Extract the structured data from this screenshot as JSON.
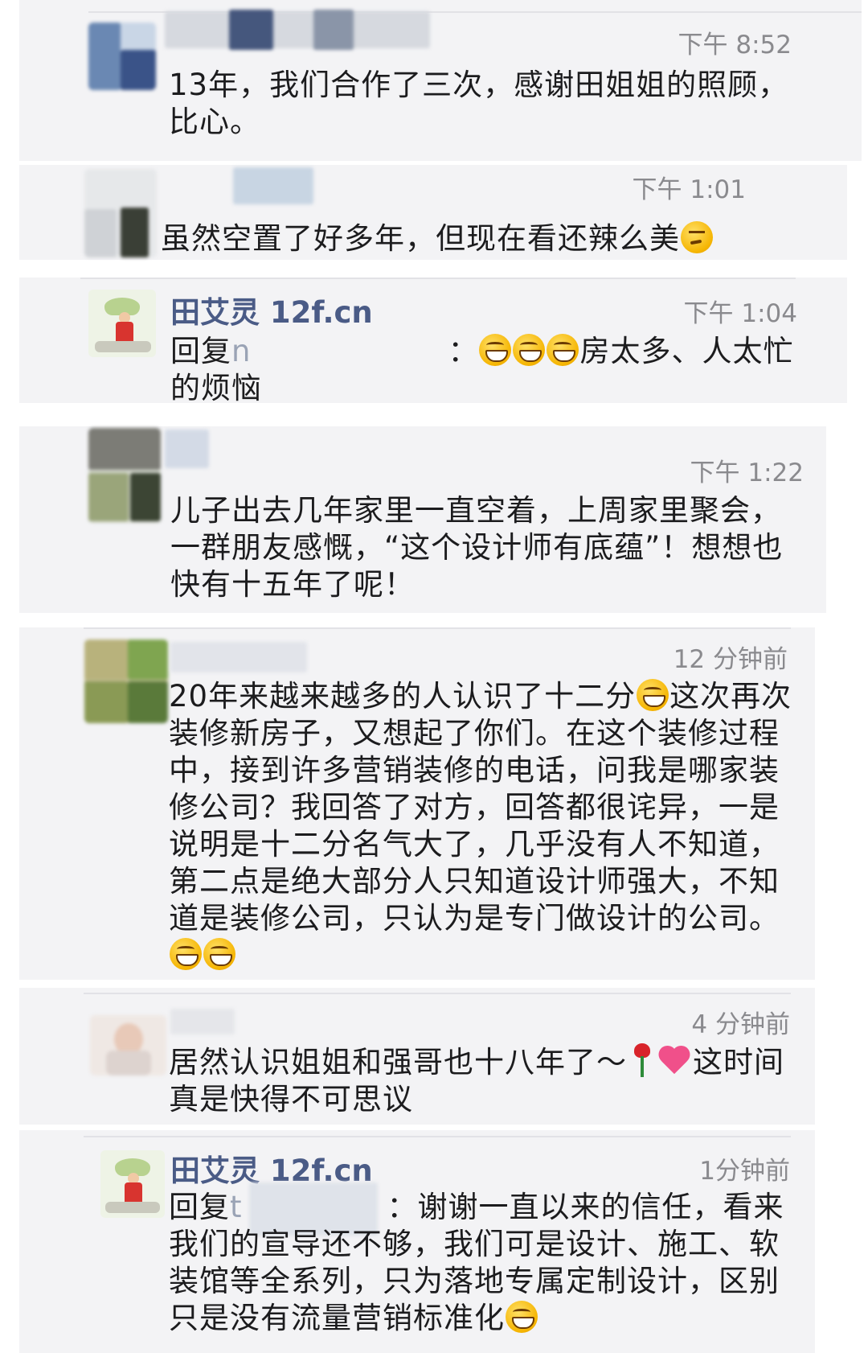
{
  "comments": [
    {
      "time": "下午 8:52",
      "text": "13年，我们合作了三次，感谢田姐姐的照顾，比心。"
    },
    {
      "time": "下午 1:01",
      "text": "虽然空置了好多年，但现在看还辣么美"
    },
    {
      "name": "田艾灵 12f.cn",
      "time": "下午 1:04",
      "reply_prefix": "回复",
      "reply_mark": "n",
      "text_colon": "：",
      "text_after": "房太多、人太忙",
      "text_line2": "的烦恼"
    },
    {
      "time": "下午 1:22",
      "text": "儿子出去几年家里一直空着，上周家里聚会，一群朋友感慨，“这个设计师有底蕴”！想想也快有十五年了呢！"
    },
    {
      "time": "12 分钟前",
      "text_a": "20年来越来越多的人认识了十二分",
      "text_b": "这次再次装修新房子，又想起了你们。在这个装修过程中，接到许多营销装修的电话，问我是哪家装修公司？我回答了对方，回答都很诧异，一是说明是十二分名气大了，几乎没有人不知道，第二点是绝大部分人只知道设计师强大，不知道是装修公司，只认为是专门做设计的公司。"
    },
    {
      "time": "4 分钟前",
      "text_a": "居然认识姐姐和强哥也十八年了～",
      "text_b": "这时间真是快得不可思议"
    },
    {
      "name": "田艾灵 12f.cn",
      "time": "1分钟前",
      "reply_prefix": "回复",
      "reply_mark": "t",
      "text": "：谢谢一直以来的信任，看来我们的宣导还不够，我们可是设计、施工、软装馆等全系列，只为落地专属定制设计，区别只是没有流量营销标准化"
    }
  ],
  "colors": {
    "background": "#f3f3f5",
    "name": "#4a5b86",
    "time": "#8a8a8e",
    "text": "#1c1c1e"
  }
}
